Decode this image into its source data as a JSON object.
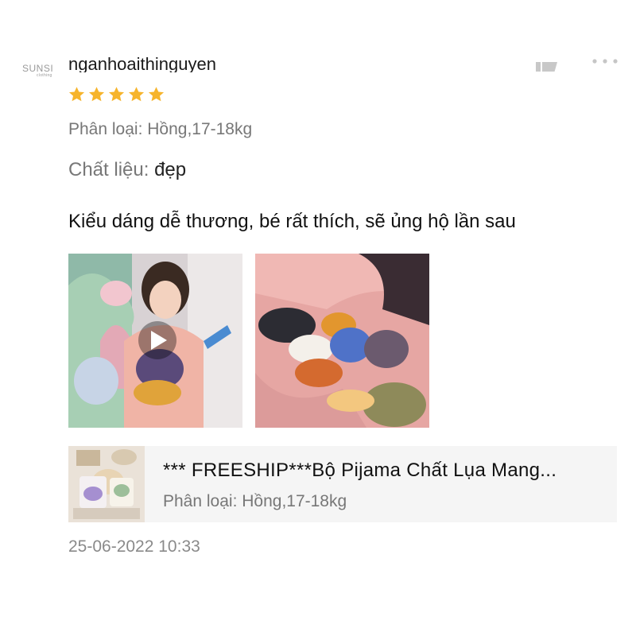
{
  "shop_logo": {
    "text": "SUNSI",
    "sub": "clothing"
  },
  "review": {
    "username": "nganhoaithinguyen",
    "rating": 5,
    "rating_max": 5,
    "variant": "Phân loại: Hồng,17-18kg",
    "material_label": "Chất liệu:",
    "material_value": "đẹp",
    "comment": "Kiểu dáng dễ thương, bé rất thích, sẽ ủng hộ lần sau",
    "media": [
      {
        "type": "video",
        "icon": "play-icon"
      },
      {
        "type": "photo"
      }
    ],
    "timestamp": "25-06-2022 10:33"
  },
  "product": {
    "title": "*** FREESHIP***Bộ Pijama Chất Lụa Mang...",
    "variant": "Phân loại: Hồng,17-18kg"
  },
  "colors": {
    "star": "#f6b42c",
    "card_bg": "#f5f5f5",
    "secondary_text": "#777777"
  },
  "icons": {
    "like": "thumbs-up-icon",
    "more": "more-options-icon"
  }
}
